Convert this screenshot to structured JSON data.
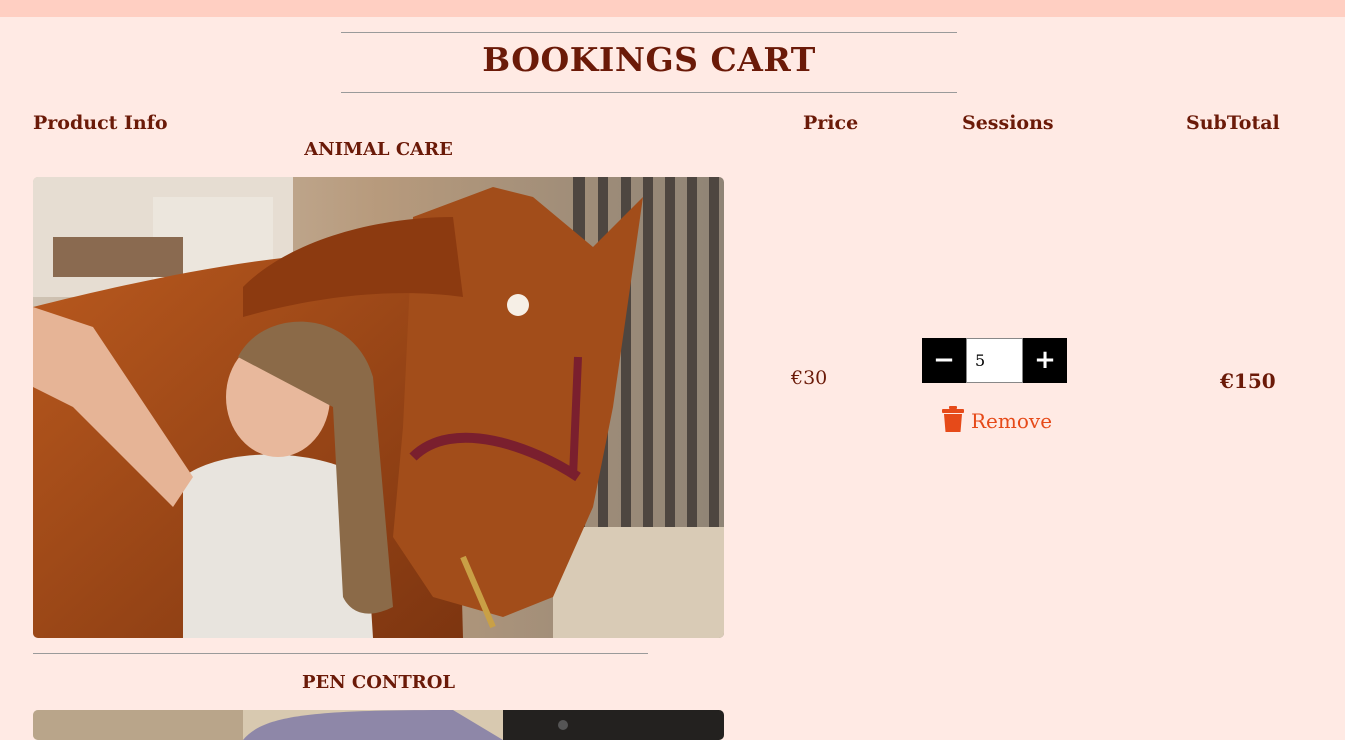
{
  "page": {
    "title": "BOOKINGS CART"
  },
  "columns": {
    "product": "Product Info",
    "price": "Price",
    "sessions": "Sessions",
    "subtotal": "SubTotal"
  },
  "items": [
    {
      "name": "ANIMAL CARE",
      "price": "€30",
      "quantity": "5",
      "remove_label": "Remove",
      "subtotal": "€150"
    },
    {
      "name": "PEN CONTROL"
    }
  ],
  "stepper": {
    "decrement": "−",
    "increment": "+"
  },
  "colors": {
    "background": "#ffeae4",
    "heading": "#6b1a08",
    "remove": "#e64a19",
    "topbar": "#ffcfc2"
  }
}
